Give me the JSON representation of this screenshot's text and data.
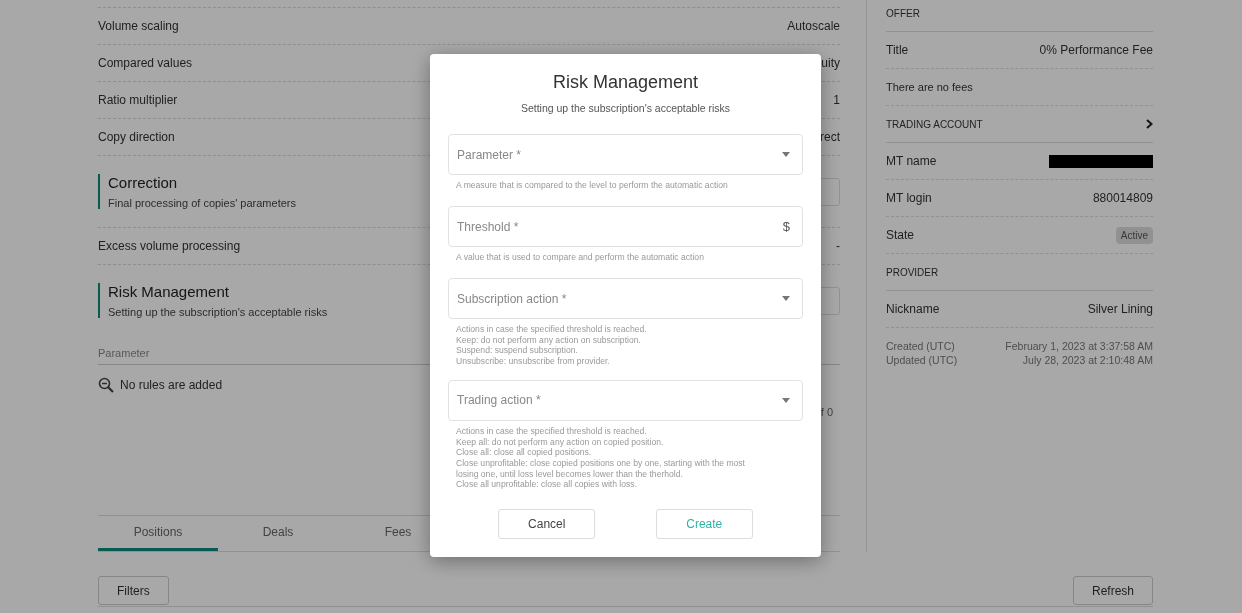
{
  "settings": {
    "rows": [
      {
        "kind": "row",
        "label": "Volume scaling",
        "value": "Autoscale"
      },
      {
        "kind": "row",
        "label": "Compared values",
        "value": "uity"
      },
      {
        "kind": "row",
        "label": "Ratio multiplier",
        "value": "1"
      },
      {
        "kind": "row",
        "label": "Copy direction",
        "value": "rect"
      },
      {
        "kind": "section",
        "title": "Correction",
        "subtitle": "Final processing of copies' parameters"
      },
      {
        "kind": "row",
        "label": "Excess volume processing",
        "value": "-"
      },
      {
        "kind": "section",
        "title": "Risk Management",
        "subtitle": "Setting up the subscription's acceptable risks"
      }
    ],
    "rules_table": {
      "column": "Parameter",
      "empty": "No rules are added",
      "pagination": "f 0"
    }
  },
  "tabs": [
    {
      "label": "Positions",
      "selected": true
    },
    {
      "label": "Deals",
      "selected": false
    },
    {
      "label": "Fees",
      "selected": false
    }
  ],
  "filters_button": "Filters",
  "refresh_button": "Refresh",
  "side_panel": [
    {
      "kind": "header",
      "label": "OFFER"
    },
    {
      "kind": "pair",
      "label": "Title",
      "value": "0% Performance Fee"
    },
    {
      "kind": "note",
      "label": "There are no fees"
    },
    {
      "kind": "link_header",
      "label": "TRADING ACCOUNT"
    },
    {
      "kind": "redacted",
      "label": "MT name"
    },
    {
      "kind": "pair",
      "label": "MT login",
      "value": "880014809"
    },
    {
      "kind": "badge",
      "label": "State",
      "value": "Active"
    },
    {
      "kind": "header",
      "label": "PROVIDER"
    },
    {
      "kind": "pair",
      "label": "Nickname",
      "value": "Silver Lining"
    },
    {
      "kind": "dates",
      "items": [
        {
          "label": "Created (UTC)",
          "value": "February 1, 2023 at 3:37:58 AM"
        },
        {
          "label": "Updated (UTC)",
          "value": "July 28, 2023 at 2:10:48 AM"
        }
      ]
    }
  ],
  "dialog": {
    "title": "Risk Management",
    "subtitle": "Setting up the subscription's acceptable risks",
    "fields": [
      {
        "kind": "select",
        "placeholder": "Parameter *",
        "help": [
          "A measure that is compared to the level to perform the automatic action"
        ]
      },
      {
        "kind": "currency",
        "placeholder": "Threshold *",
        "suffix": "$",
        "help": [
          "A value that is used to compare and perform the automatic action"
        ]
      },
      {
        "kind": "select",
        "placeholder": "Subscription action *",
        "help": [
          "Actions in case the specified threshold is reached.",
          "Keep: do not perform any action on subscription.",
          "Suspend: suspend subscription.",
          "Unsubscribe: unsubscribe from provider."
        ]
      },
      {
        "kind": "select",
        "placeholder": "Trading action *",
        "help": [
          "Actions in case the specified threshold is reached.",
          "Keep all: do not perform any action on copied position.",
          "Close all: close all copied positions.",
          "Close unprofitable: close copied positions one by one, starting with the most",
          "losing one, until loss level becomes lower than the therhold.",
          "Close all unprofitable: close all copies with loss."
        ]
      }
    ],
    "cancel": "Cancel",
    "create": "Create"
  }
}
